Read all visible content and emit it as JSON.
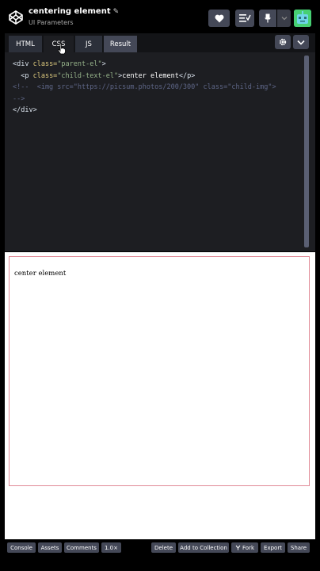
{
  "header": {
    "title": "centering element",
    "subtitle": "UI Parameters",
    "icons": [
      "codepen-logo-icon",
      "pencil-icon",
      "heart-icon",
      "change-view-icon",
      "pin-icon",
      "chevron-down-icon",
      "user-avatar"
    ]
  },
  "editor": {
    "tabs": [
      "HTML",
      "CSS",
      "JS",
      "Result"
    ],
    "active_tab": "CSS",
    "code_lines": [
      [
        "<div ",
        "class=",
        "\"parent-el\"",
        ">"
      ],
      [
        "  <p ",
        "class=",
        "\"child-text-el\"",
        ">",
        "center element",
        "</p>"
      ],
      [
        "<!--  <img src=\"https://picsum.photos/200/300\" class=\"child-img\">"
      ],
      [
        "-->"
      ],
      [
        "</div>"
      ]
    ]
  },
  "preview": {
    "text": "center element"
  },
  "footer": {
    "left_buttons": [
      "Console",
      "Assets",
      "Comments",
      "1.0×"
    ],
    "right_buttons": [
      "Delete",
      "Add to Collection",
      "Fork",
      "Export",
      "Share"
    ]
  },
  "colors": {
    "accent_green": "#47cf73",
    "button_gray": "#444857",
    "editor_bg": "#1d1e22",
    "border_pink": "#e08a97"
  }
}
